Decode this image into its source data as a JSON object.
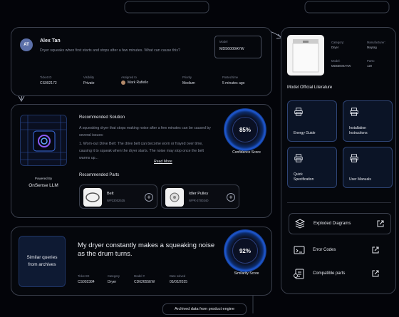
{
  "ticket": {
    "avatar_initials": "AT",
    "user_name": "Alex Tan",
    "message": "Dryer squeaks when first starts and stops after a few minutes. What can cause this?",
    "model_label": "Model",
    "model_value": "MD56000AYW",
    "fields": [
      {
        "label": "Ticket ID",
        "value": "CS002172"
      },
      {
        "label": "Visibility",
        "value": "Private"
      },
      {
        "label": "Assigned to",
        "value": "Mark Rafiello"
      },
      {
        "label": "Priority",
        "value": "Medium"
      },
      {
        "label": "Posted time",
        "value": "5 minutes ago"
      }
    ]
  },
  "solution": {
    "heading": "Recommended Solution",
    "text": "A squeaking dryer that stops making noise after a few minutes can be caused by several issues:",
    "text2": "1. Worn-out Drive Belt: The drive belt can become worn or frayed over time, causing it to squeak when the dryer starts. The noise may stop once the belt warms up...",
    "read_more": "Read More",
    "confidence_value": "85%",
    "confidence_value_num": 85,
    "confidence_label": "Confidence Score",
    "powered_label": "Powered By",
    "powered_name": "OnSense LLM",
    "parts_heading": "Recommended Parts",
    "parts": [
      {
        "name": "Belt",
        "code": "WP33002535"
      },
      {
        "name": "Idler Pulley",
        "code": "WPR-3700340"
      }
    ]
  },
  "similar": {
    "side_label": "Similar queries from archives",
    "question": "My dryer constantly makes a squeaking noise as the drum turns.",
    "similarity_value": "92%",
    "similarity_value_num": 92,
    "similarity_label": "Similarity Score",
    "fields": [
      {
        "label": "Ticket ID",
        "value": "CS002384"
      },
      {
        "label": "Category",
        "value": "Dryer"
      },
      {
        "label": "Model #",
        "value": "CD62655EW"
      },
      {
        "label": "Date solved",
        "value": "05/02/2025"
      }
    ],
    "footer": "Archived data from product engine"
  },
  "product": {
    "category_label": "Category:",
    "category_value": "Dryer",
    "manufacturer_label": "Manufacturer:",
    "manufacturer_value": "Maytag",
    "model_label": "Model:",
    "model_value": "MD56000AYW",
    "parts_label": "Parts:",
    "parts_value": "120"
  },
  "literature": {
    "heading": "Model Official Literature",
    "docs": [
      {
        "label": "Energy Guide",
        "icon": "printer-icon"
      },
      {
        "label": "Installation Instructions",
        "icon": "printer-icon"
      },
      {
        "label": "Quick Specification",
        "icon": "printer-icon"
      },
      {
        "label": "User Manuals",
        "icon": "printer-icon"
      }
    ],
    "links": [
      {
        "label": "Exploded Diagrams",
        "icon": "exploded-diagram-icon"
      },
      {
        "label": "Error Codes",
        "icon": "error-code-icon"
      },
      {
        "label": "Compatible parts",
        "icon": "compatible-parts-icon"
      }
    ]
  },
  "colors": {
    "accent": "#1e5ad6",
    "panel_border": "#3a3f4c",
    "doc_card_bg": "#0b1426"
  }
}
